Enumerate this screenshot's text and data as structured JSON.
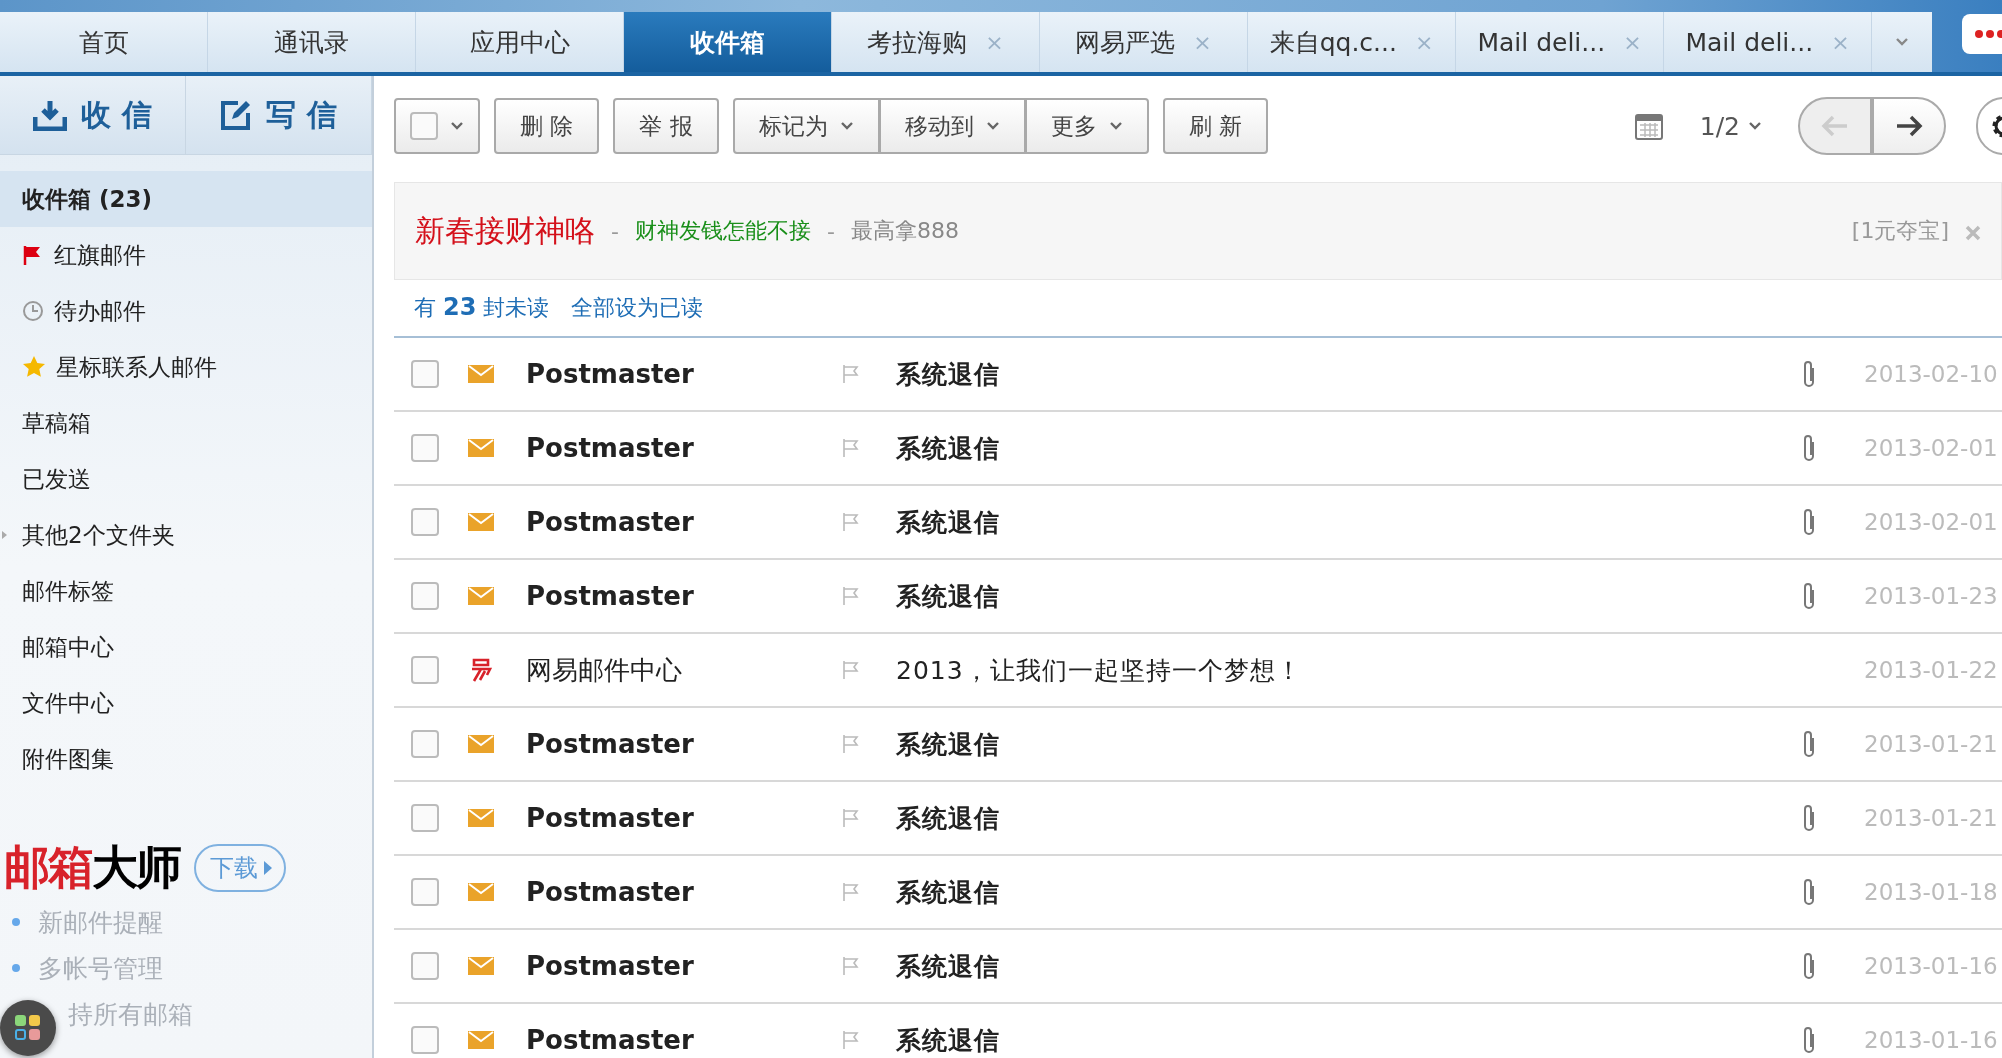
{
  "tabs": [
    {
      "label": "首页",
      "selected": false
    },
    {
      "label": "通讯录",
      "selected": false
    },
    {
      "label": "应用中心",
      "selected": false
    },
    {
      "label": "收件箱",
      "selected": true
    },
    {
      "label": "考拉海购",
      "selected": false,
      "close": "×"
    },
    {
      "label": "网易严选",
      "selected": false,
      "close": "×"
    },
    {
      "label": "来自qq.c...",
      "selected": false,
      "close": "×"
    },
    {
      "label": "Mail deli...",
      "selected": false,
      "close": "×"
    },
    {
      "label": "Mail deli...",
      "selected": false,
      "close": "×"
    }
  ],
  "sidebar": {
    "actions": [
      {
        "kind": "receive",
        "label": "收 信"
      },
      {
        "kind": "compose",
        "label": "写 信"
      }
    ],
    "folders": [
      {
        "label": "收件箱 (23)",
        "selected": true,
        "kind": "plain"
      },
      {
        "label": "红旗邮件",
        "selected": false,
        "kind": "flag"
      },
      {
        "label": "待办邮件",
        "selected": false,
        "kind": "clock"
      },
      {
        "label": "星标联系人邮件",
        "selected": false,
        "kind": "star"
      },
      {
        "label": "草稿箱",
        "selected": false,
        "kind": "plain"
      },
      {
        "label": "已发送",
        "selected": false,
        "kind": "plain"
      },
      {
        "label": "其他2个文件夹",
        "selected": false,
        "kind": "group"
      },
      {
        "label": "邮件标签",
        "selected": false,
        "kind": "plain"
      },
      {
        "label": "邮箱中心",
        "selected": false,
        "kind": "plain"
      },
      {
        "label": "文件中心",
        "selected": false,
        "kind": "plain"
      },
      {
        "label": "附件图集",
        "selected": false,
        "kind": "plain"
      }
    ],
    "promo": {
      "logo": [
        "邮箱",
        "大师"
      ],
      "button": "下载",
      "features": [
        "新邮件提醒",
        "多帐号管理",
        "持所有邮箱"
      ]
    }
  },
  "toolbar": {
    "buttons": [
      {
        "kind": "plain",
        "label": "删 除"
      },
      {
        "kind": "plain",
        "label": "举 报"
      },
      {
        "kind": "menu",
        "label": "标记为"
      },
      {
        "kind": "menu",
        "label": "移动到"
      },
      {
        "kind": "menu",
        "label": "更多"
      },
      {
        "kind": "plain",
        "label": "刷 新"
      }
    ],
    "page": "1/2"
  },
  "banner": {
    "title": "新春接财神咯",
    "sep1": "-",
    "subtitle": "财神发钱怎能不接",
    "sep2": "-",
    "note": "最高拿888",
    "link": "[1元夺宝]"
  },
  "unread_bar": {
    "text": "有 **23** 封未读",
    "action": "全部设为已读"
  },
  "mails": [
    {
      "kind": "bounce",
      "unread": true,
      "sender": "Postmaster",
      "subject": "系统退信",
      "attachment": true,
      "date": "2013-02-10",
      "checked": false
    },
    {
      "kind": "bounce",
      "unread": true,
      "sender": "Postmaster",
      "subject": "系统退信",
      "attachment": true,
      "date": "2013-02-01",
      "checked": false
    },
    {
      "kind": "bounce",
      "unread": true,
      "sender": "Postmaster",
      "subject": "系统退信",
      "attachment": true,
      "date": "2013-02-01",
      "checked": false
    },
    {
      "kind": "bounce",
      "unread": true,
      "sender": "Postmaster",
      "subject": "系统退信",
      "attachment": true,
      "date": "2013-01-23",
      "checked": false
    },
    {
      "kind": "service",
      "unread": false,
      "sender": "网易邮件中心",
      "subject": "2013，让我们一起坚持一个梦想！",
      "attachment": false,
      "date": "2013-01-22",
      "checked": false
    },
    {
      "kind": "bounce",
      "unread": true,
      "sender": "Postmaster",
      "subject": "系统退信",
      "attachment": true,
      "date": "2013-01-21",
      "checked": false
    },
    {
      "kind": "bounce",
      "unread": true,
      "sender": "Postmaster",
      "subject": "系统退信",
      "attachment": true,
      "date": "2013-01-21",
      "checked": false
    },
    {
      "kind": "bounce",
      "unread": true,
      "sender": "Postmaster",
      "subject": "系统退信",
      "attachment": true,
      "date": "2013-01-18",
      "checked": false
    },
    {
      "kind": "bounce",
      "unread": true,
      "sender": "Postmaster",
      "subject": "系统退信",
      "attachment": true,
      "date": "2013-01-16",
      "checked": false
    },
    {
      "kind": "bounce",
      "unread": true,
      "sender": "Postmaster",
      "subject": "系统退信",
      "attachment": true,
      "date": "2013-01-16",
      "checked": false
    }
  ]
}
